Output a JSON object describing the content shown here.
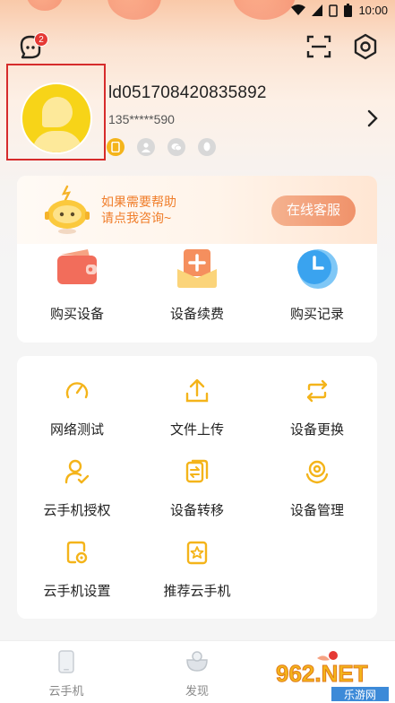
{
  "status_bar": {
    "time": "10:00",
    "icons": [
      "wifi-icon",
      "signal-icon",
      "sim-icon",
      "battery-icon"
    ]
  },
  "header": {
    "message_badge": "2",
    "icons": [
      "message-icon",
      "scan-icon",
      "settings-icon"
    ]
  },
  "profile": {
    "user_id": "ld051708420835892",
    "phone": "135*****590",
    "bindings": [
      {
        "name": "phone-bind-icon",
        "active": true
      },
      {
        "name": "person-bind-icon",
        "active": false
      },
      {
        "name": "wechat-bind-icon",
        "active": false
      },
      {
        "name": "qq-bind-icon",
        "active": false
      }
    ]
  },
  "help": {
    "text_line1": "如果需要帮助",
    "text_line2": "请点我咨询~",
    "button": "在线客服"
  },
  "quick_actions": [
    {
      "label": "购买设备",
      "icon": "wallet-icon"
    },
    {
      "label": "设备续费",
      "icon": "renew-icon"
    },
    {
      "label": "购买记录",
      "icon": "clock-icon"
    }
  ],
  "tools": [
    {
      "label": "网络测试",
      "icon": "speedometer-icon"
    },
    {
      "label": "文件上传",
      "icon": "upload-icon"
    },
    {
      "label": "设备更换",
      "icon": "swap-icon"
    },
    {
      "label": "云手机授权",
      "icon": "user-check-icon"
    },
    {
      "label": "设备转移",
      "icon": "transfer-icon"
    },
    {
      "label": "设备管理",
      "icon": "manage-icon"
    },
    {
      "label": "云手机设置",
      "icon": "phone-settings-icon"
    },
    {
      "label": "推荐云手机",
      "icon": "star-icon"
    }
  ],
  "nav": {
    "items": [
      {
        "label": "云手机",
        "icon": "phone-tab-icon"
      },
      {
        "label": "发现",
        "icon": "discover-tab-icon"
      }
    ]
  },
  "watermark": {
    "brand": "962.NET",
    "sub": "乐游网"
  },
  "colors": {
    "accent": "#f4b41a",
    "help_text": "#f07e2b",
    "help_button": "#f0926a",
    "badge": "#e53935",
    "avatar": "#f7d418"
  }
}
